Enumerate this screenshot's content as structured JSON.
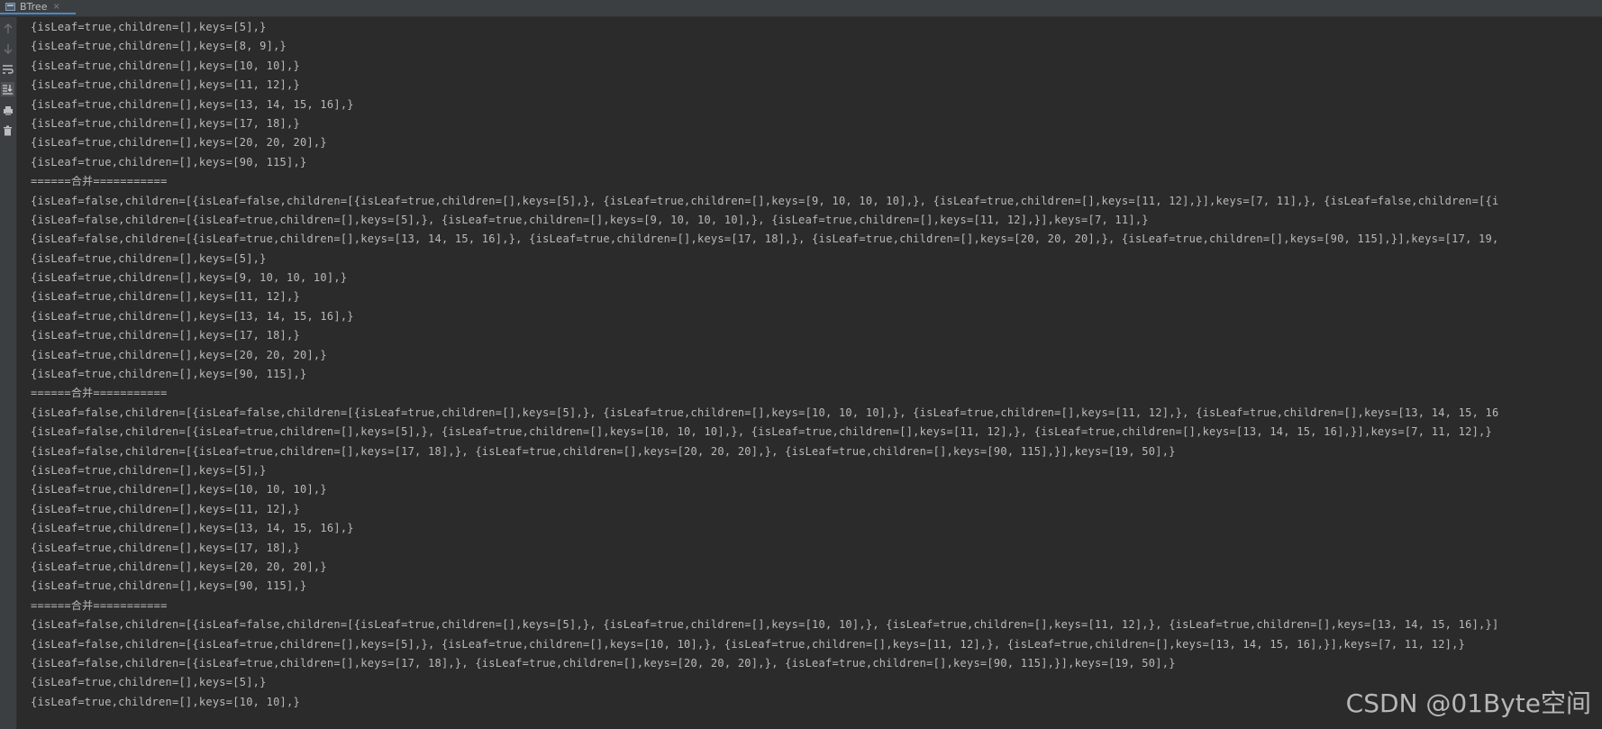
{
  "tab": {
    "title": "BTree",
    "close": "×",
    "icon": "run-console-icon"
  },
  "toolbar": {
    "icons": [
      "arrow-up-icon",
      "arrow-down-icon",
      "soft-wrap-icon",
      "scroll-to-end-icon",
      "print-icon",
      "trash-icon"
    ]
  },
  "console": {
    "lines": [
      "{isLeaf=true,children=[],keys=[5],}",
      "{isLeaf=true,children=[],keys=[8, 9],}",
      "{isLeaf=true,children=[],keys=[10, 10],}",
      "{isLeaf=true,children=[],keys=[11, 12],}",
      "{isLeaf=true,children=[],keys=[13, 14, 15, 16],}",
      "{isLeaf=true,children=[],keys=[17, 18],}",
      "{isLeaf=true,children=[],keys=[20, 20, 20],}",
      "{isLeaf=true,children=[],keys=[90, 115],}",
      "======合并===========",
      "{isLeaf=false,children=[{isLeaf=false,children=[{isLeaf=true,children=[],keys=[5],}, {isLeaf=true,children=[],keys=[9, 10, 10, 10],}, {isLeaf=true,children=[],keys=[11, 12],}],keys=[7, 11],}, {isLeaf=false,children=[{i",
      "{isLeaf=false,children=[{isLeaf=true,children=[],keys=[5],}, {isLeaf=true,children=[],keys=[9, 10, 10, 10],}, {isLeaf=true,children=[],keys=[11, 12],}],keys=[7, 11],}",
      "{isLeaf=false,children=[{isLeaf=true,children=[],keys=[13, 14, 15, 16],}, {isLeaf=true,children=[],keys=[17, 18],}, {isLeaf=true,children=[],keys=[20, 20, 20],}, {isLeaf=true,children=[],keys=[90, 115],}],keys=[17, 19,",
      "{isLeaf=true,children=[],keys=[5],}",
      "{isLeaf=true,children=[],keys=[9, 10, 10, 10],}",
      "{isLeaf=true,children=[],keys=[11, 12],}",
      "{isLeaf=true,children=[],keys=[13, 14, 15, 16],}",
      "{isLeaf=true,children=[],keys=[17, 18],}",
      "{isLeaf=true,children=[],keys=[20, 20, 20],}",
      "{isLeaf=true,children=[],keys=[90, 115],}",
      "======合并===========",
      "{isLeaf=false,children=[{isLeaf=false,children=[{isLeaf=true,children=[],keys=[5],}, {isLeaf=true,children=[],keys=[10, 10, 10],}, {isLeaf=true,children=[],keys=[11, 12],}, {isLeaf=true,children=[],keys=[13, 14, 15, 16",
      "{isLeaf=false,children=[{isLeaf=true,children=[],keys=[5],}, {isLeaf=true,children=[],keys=[10, 10, 10],}, {isLeaf=true,children=[],keys=[11, 12],}, {isLeaf=true,children=[],keys=[13, 14, 15, 16],}],keys=[7, 11, 12],}",
      "{isLeaf=false,children=[{isLeaf=true,children=[],keys=[17, 18],}, {isLeaf=true,children=[],keys=[20, 20, 20],}, {isLeaf=true,children=[],keys=[90, 115],}],keys=[19, 50],}",
      "{isLeaf=true,children=[],keys=[5],}",
      "{isLeaf=true,children=[],keys=[10, 10, 10],}",
      "{isLeaf=true,children=[],keys=[11, 12],}",
      "{isLeaf=true,children=[],keys=[13, 14, 15, 16],}",
      "{isLeaf=true,children=[],keys=[17, 18],}",
      "{isLeaf=true,children=[],keys=[20, 20, 20],}",
      "{isLeaf=true,children=[],keys=[90, 115],}",
      "======合并===========",
      "{isLeaf=false,children=[{isLeaf=false,children=[{isLeaf=true,children=[],keys=[5],}, {isLeaf=true,children=[],keys=[10, 10],}, {isLeaf=true,children=[],keys=[11, 12],}, {isLeaf=true,children=[],keys=[13, 14, 15, 16],}]",
      "{isLeaf=false,children=[{isLeaf=true,children=[],keys=[5],}, {isLeaf=true,children=[],keys=[10, 10],}, {isLeaf=true,children=[],keys=[11, 12],}, {isLeaf=true,children=[],keys=[13, 14, 15, 16],}],keys=[7, 11, 12],}",
      "{isLeaf=false,children=[{isLeaf=true,children=[],keys=[17, 18],}, {isLeaf=true,children=[],keys=[20, 20, 20],}, {isLeaf=true,children=[],keys=[90, 115],}],keys=[19, 50],}",
      "{isLeaf=true,children=[],keys=[5],}",
      "{isLeaf=true,children=[],keys=[10, 10],}"
    ]
  },
  "watermark": "CSDN @01Byte空间",
  "colors": {
    "background": "#2b2b2b",
    "text": "#bababa",
    "tab_underline": "#4a88c7"
  }
}
